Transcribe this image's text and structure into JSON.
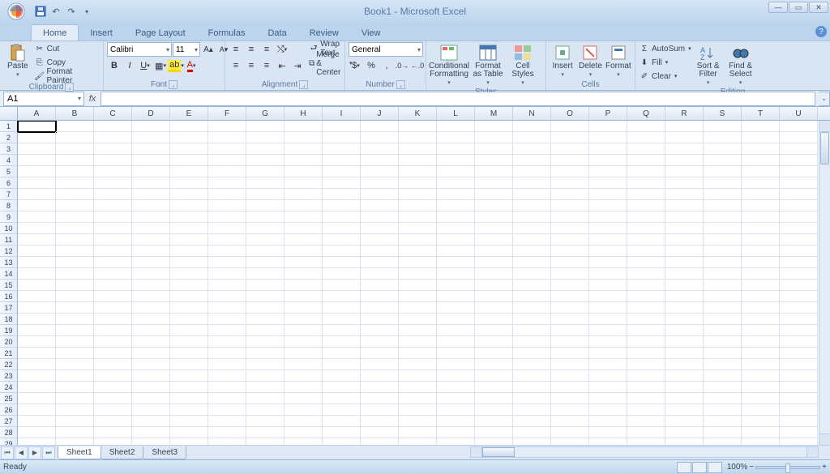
{
  "title": "Book1 - Microsoft Excel",
  "qat": {
    "save": "save-icon",
    "undo": "undo-icon",
    "redo": "redo-icon"
  },
  "tabs": [
    "Home",
    "Insert",
    "Page Layout",
    "Formulas",
    "Data",
    "Review",
    "View"
  ],
  "active_tab": "Home",
  "ribbon": {
    "clipboard": {
      "label": "Clipboard",
      "paste": "Paste",
      "cut": "Cut",
      "copy": "Copy",
      "fp": "Format Painter"
    },
    "font": {
      "label": "Font",
      "name": "Calibri",
      "size": "11"
    },
    "alignment": {
      "label": "Alignment",
      "wrap": "Wrap Text",
      "merge": "Merge & Center"
    },
    "number": {
      "label": "Number",
      "format": "General"
    },
    "styles": {
      "label": "Styles",
      "cond": "Conditional\nFormatting",
      "fat": "Format\nas Table",
      "cell": "Cell\nStyles"
    },
    "cells": {
      "label": "Cells",
      "ins": "Insert",
      "del": "Delete",
      "fmt": "Format"
    },
    "editing": {
      "label": "Editing",
      "sum": "AutoSum",
      "fill": "Fill",
      "clear": "Clear",
      "sort": "Sort &\nFilter",
      "find": "Find &\nSelect"
    }
  },
  "namebox": "A1",
  "columns": [
    "A",
    "B",
    "C",
    "D",
    "E",
    "F",
    "G",
    "H",
    "I",
    "J",
    "K",
    "L",
    "M",
    "N",
    "O",
    "P",
    "Q",
    "R",
    "S",
    "T",
    "U"
  ],
  "rows": 29,
  "sheets": [
    "Sheet1",
    "Sheet2",
    "Sheet3"
  ],
  "active_sheet": "Sheet1",
  "status": {
    "ready": "Ready",
    "zoom": "100%"
  }
}
